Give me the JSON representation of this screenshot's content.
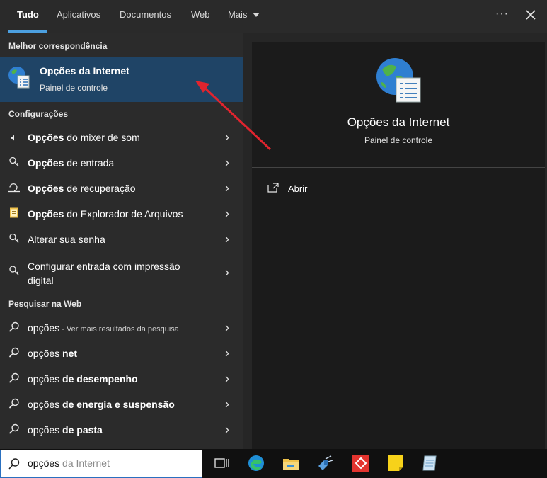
{
  "tabs": [
    {
      "label": "Tudo",
      "active": true
    },
    {
      "label": "Aplicativos"
    },
    {
      "label": "Documentos"
    },
    {
      "label": "Web"
    },
    {
      "label": "Mais"
    }
  ],
  "best_match": {
    "header": "Melhor correspondência",
    "title": "Opções da Internet",
    "subtitle": "Painel de controle"
  },
  "settings": {
    "header": "Configurações",
    "items": [
      {
        "bold": "Opções",
        "rest": " do mixer de som",
        "icon": "speaker-icon"
      },
      {
        "bold": "Opções",
        "rest": " de entrada",
        "icon": "magnifier-key-icon"
      },
      {
        "bold": "Opções",
        "rest": " de recuperação",
        "icon": "recovery-icon"
      },
      {
        "bold": "Opções",
        "rest": " do Explorador de Arquivos",
        "icon": "folder-options-icon"
      },
      {
        "text": "Alterar sua senha",
        "icon": "key-icon"
      },
      {
        "line1": "Configurar entrada com impressão",
        "line2": "digital",
        "icon": "fingerprint-icon"
      }
    ]
  },
  "web": {
    "header": "Pesquisar na Web",
    "items": [
      {
        "pre": "opções",
        "mid": " - ",
        "hint": "Ver mais resultados da pesquisa"
      },
      {
        "pre": "opções ",
        "bold": "net"
      },
      {
        "pre": "opções ",
        "bold": "de desempenho"
      },
      {
        "pre": "opções ",
        "bold": "de energia e suspensão"
      },
      {
        "pre": "opções ",
        "bold": "de pasta"
      }
    ]
  },
  "detail": {
    "title": "Opções da Internet",
    "subtitle": "Painel de controle",
    "open_label": "Abrir"
  },
  "search": {
    "typed": "opções",
    "completion": " da Internet"
  },
  "colors": {
    "accent": "#4ca0e0",
    "selected_row": "#1f4466",
    "arrow": "#e0242e"
  }
}
